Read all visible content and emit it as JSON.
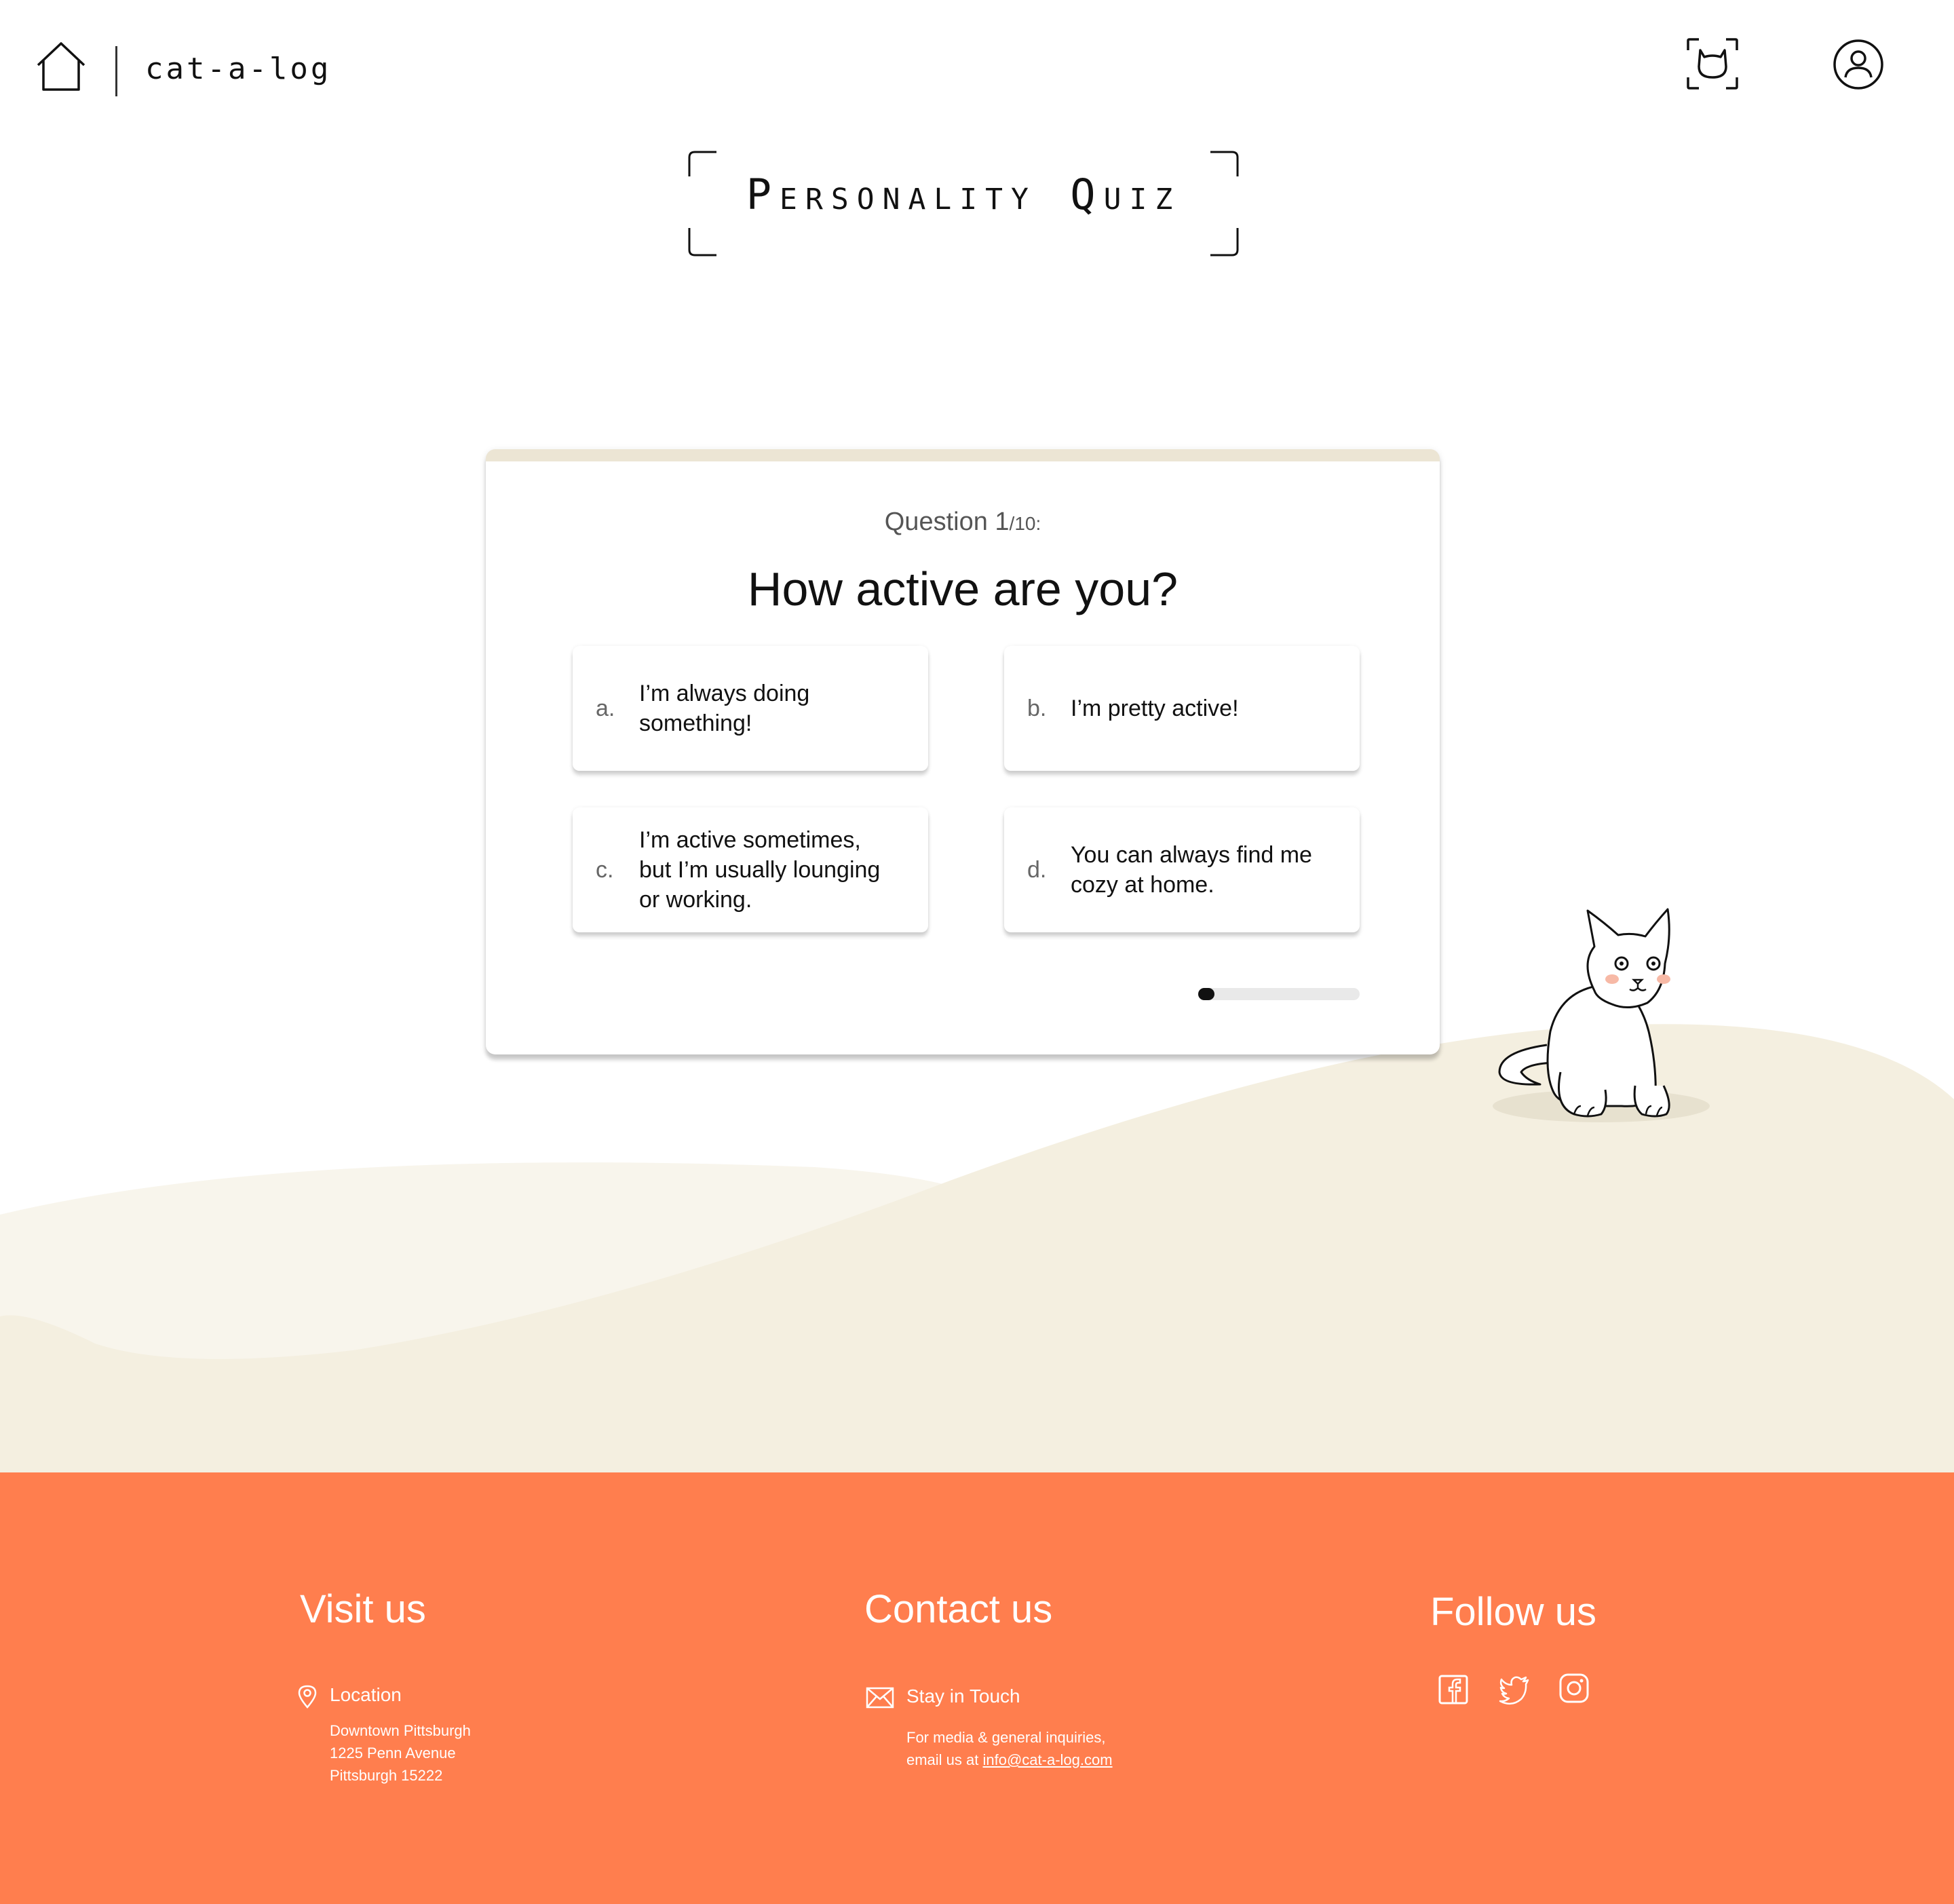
{
  "header": {
    "brand": "cat-a-log",
    "home_icon": "home-icon",
    "scan_icon": "cat-scan-icon",
    "profile_icon": "user-profile-icon"
  },
  "page": {
    "title": "Personality Quiz"
  },
  "quiz": {
    "question_prefix": "Question 1",
    "question_total": "/10:",
    "question_text": "How active are you?",
    "answers": [
      {
        "letter": "a.",
        "text": "I’m always doing something!"
      },
      {
        "letter": "b.",
        "text": "I’m pretty active!"
      },
      {
        "letter": "c.",
        "text": "I’m active sometimes, but I’m usually lounging or working."
      },
      {
        "letter": "d.",
        "text": "You can always find me cozy at home."
      }
    ],
    "progress_fraction": 0.1
  },
  "footer": {
    "visit": {
      "heading": "Visit us",
      "label": "Location",
      "address": [
        "Downtown Pittsburgh",
        "1225 Penn Avenue",
        "Pittsburgh 15222"
      ]
    },
    "contact": {
      "heading": "Contact us",
      "label": "Stay in Touch",
      "line1": "For media & general inquiries,",
      "line2_prefix": "email us at ",
      "email": "info@cat-a-log.com"
    },
    "follow": {
      "heading": "Follow us",
      "icons": [
        "facebook-icon",
        "twitter-icon",
        "instagram-icon"
      ]
    },
    "background_color": "#ff7e4e"
  },
  "colors": {
    "hill": "#f4efe0",
    "hill_light": "#f8f5ec",
    "card_top": "#ece5d4",
    "cheek": "#f7b9a6"
  }
}
